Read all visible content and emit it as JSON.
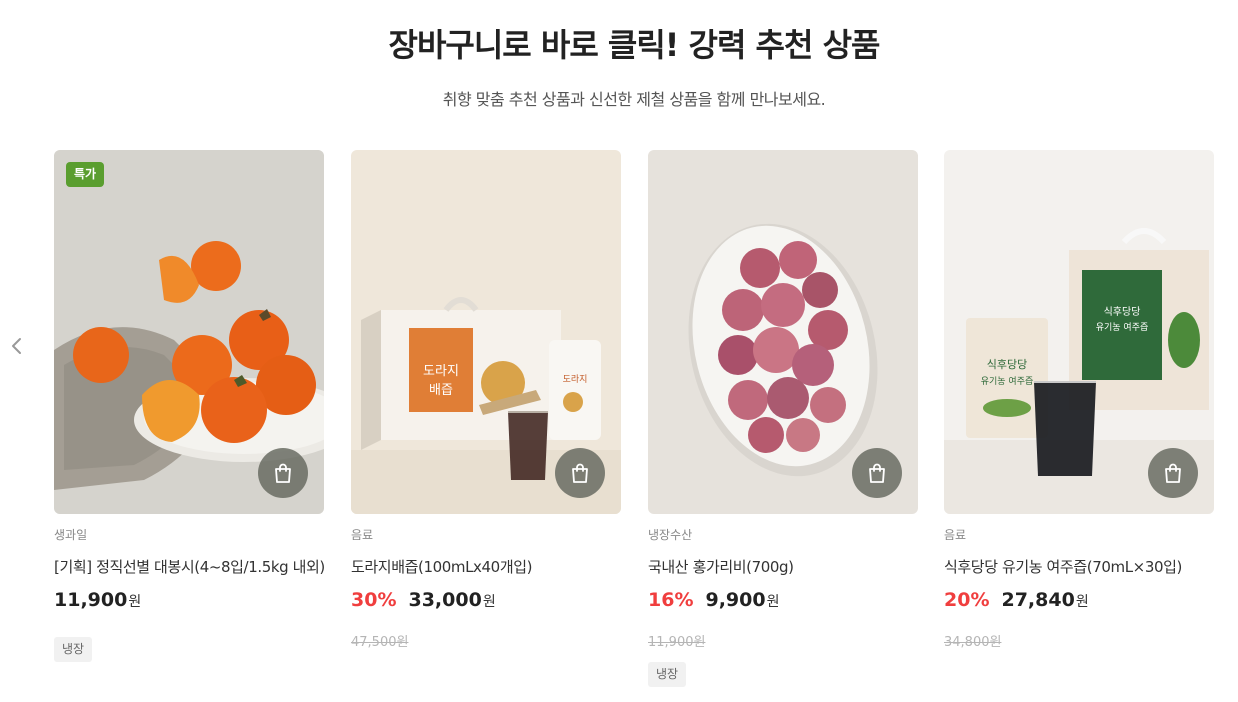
{
  "section": {
    "title": "장바구니로 바로 클릭! 강력 추천 상품",
    "subtitle": "취향 맞춤 추천 상품과 신선한 제철 상품을 함께 만나보세요."
  },
  "icons": {
    "prev": "chevron-left-icon",
    "cart": "shopping-bag-icon"
  },
  "colors": {
    "discount": "#f03e3e",
    "special_badge": "#5a9e2f",
    "cart_button": "#64685e"
  },
  "products": [
    {
      "badge": "특가",
      "category": "생과일",
      "name": "[기획] 정직선별 대봉시(4~8입/1.5kg 내외)",
      "discount": "",
      "price": "11,900",
      "currency": "원",
      "original_price": "",
      "tag": "냉장"
    },
    {
      "badge": "",
      "category": "음료",
      "name": "도라지배즙(100mLx40개입)",
      "discount": "30%",
      "price": "33,000",
      "currency": "원",
      "original_price": "47,500원",
      "tag": "",
      "package_label_line1": "도라지",
      "package_label_line2": "배즙"
    },
    {
      "badge": "",
      "category": "냉장수산",
      "name": "국내산 홍가리비(700g)",
      "discount": "16%",
      "price": "9,900",
      "currency": "원",
      "original_price": "11,900원",
      "tag": "냉장"
    },
    {
      "badge": "",
      "category": "음료",
      "name": "식후당당 유기농 여주즙(70mL×30입)",
      "discount": "20%",
      "price": "27,840",
      "currency": "원",
      "original_price": "34,800원",
      "tag": "",
      "package_label_line1": "식후당당",
      "package_label_line2": "유기농 여주즙"
    }
  ]
}
